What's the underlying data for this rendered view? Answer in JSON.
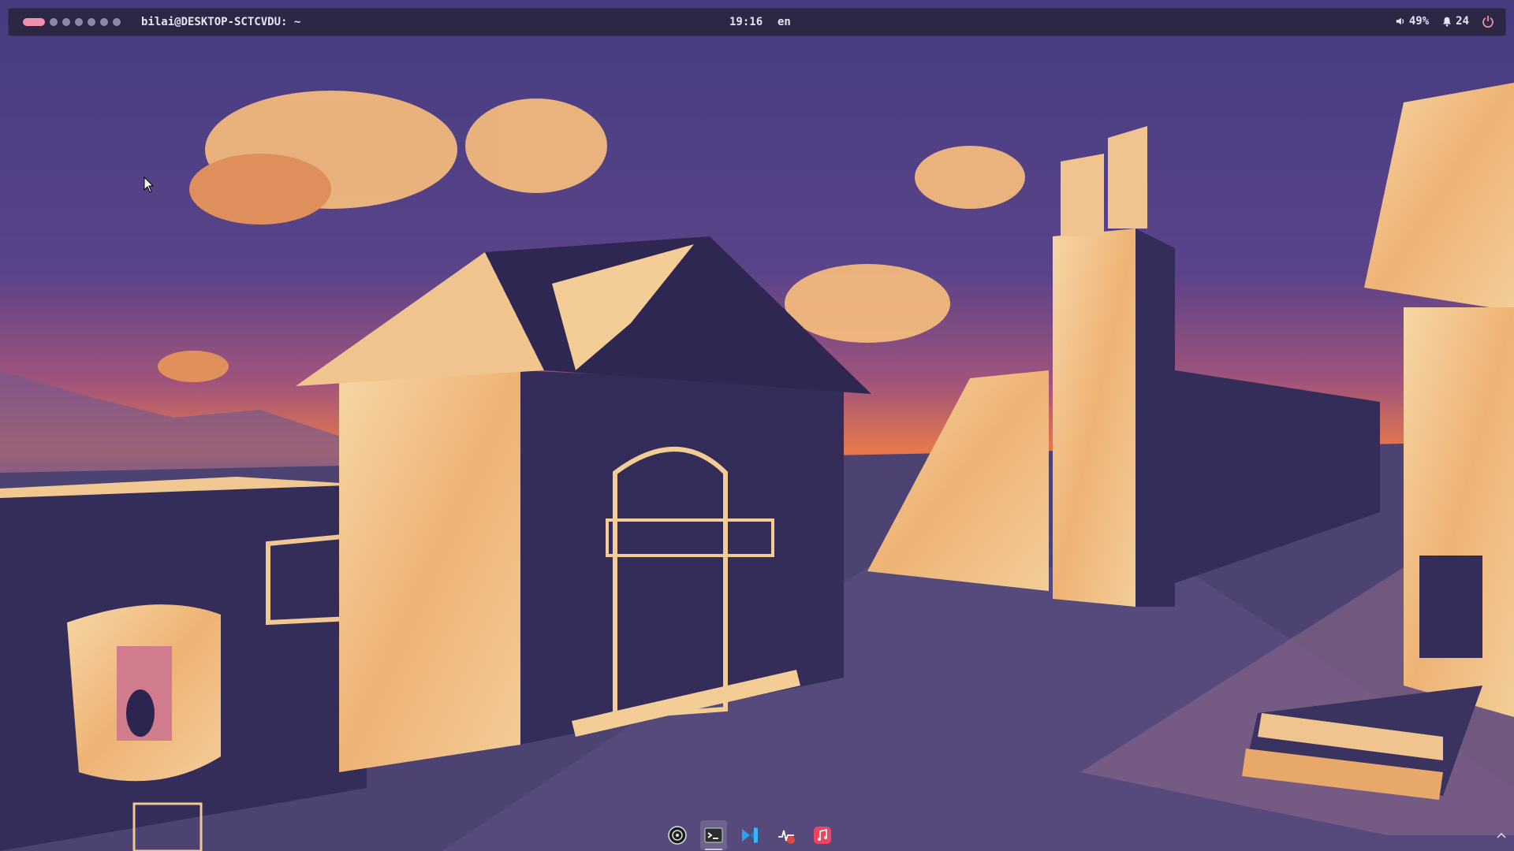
{
  "topbar": {
    "window_title": "bilai@DESKTOP-SCTCVDU: ~",
    "clock": "19:16",
    "language": "en",
    "volume": "49%",
    "notifications": "24",
    "workspaces": [
      {
        "active": true
      },
      {
        "active": false
      },
      {
        "active": false
      },
      {
        "active": false
      },
      {
        "active": false
      },
      {
        "active": false
      },
      {
        "active": false
      }
    ]
  },
  "dock": {
    "apps": [
      {
        "name": "obs-studio-icon",
        "active": false
      },
      {
        "name": "terminal-icon",
        "active": true
      },
      {
        "name": "vscode-icon",
        "active": false
      },
      {
        "name": "system-monitor-icon",
        "active": false
      },
      {
        "name": "music-icon",
        "active": false
      }
    ]
  },
  "colors": {
    "bar_bg": "#2b2745",
    "accent_pink": "#f28fad",
    "sky_top": "#4a3f85",
    "sky_horizon": "#e8784a",
    "building_shadow": "#332c58",
    "building_light": "#f0c48e"
  }
}
